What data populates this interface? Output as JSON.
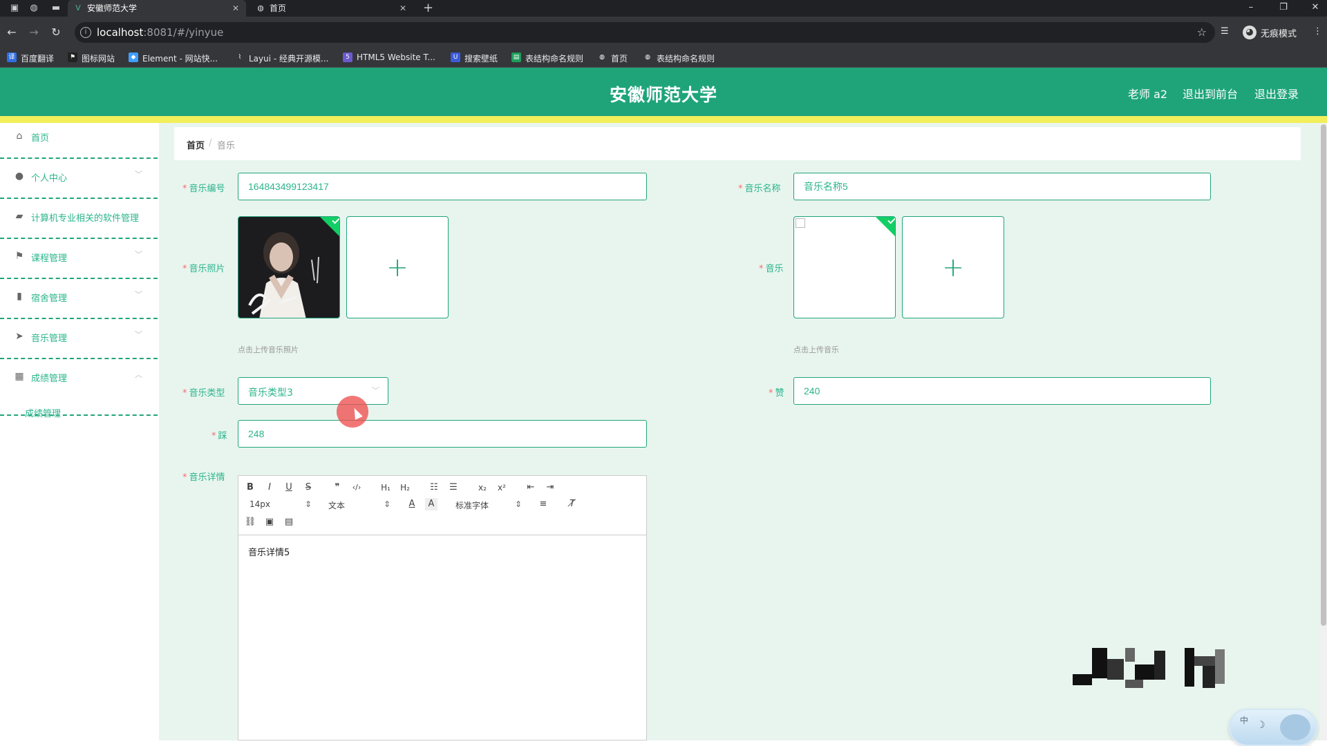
{
  "browser": {
    "tabs": [
      {
        "title": "安徽师范大学",
        "active": true
      },
      {
        "title": "首页",
        "active": false
      }
    ],
    "url_host": "localhost",
    "url_rest": ":8081/#/yinyue",
    "profile_label": "无痕模式",
    "bookmarks": [
      "百度翻译",
      "图标网站",
      "Element - 网站快...",
      "Layui - 经典开源模...",
      "HTML5 Website T...",
      "搜索壁纸",
      "表结构命名规则",
      "首页",
      "表结构命名规则"
    ]
  },
  "header": {
    "title": "安徽师范大学",
    "user": "老师 a2",
    "to_front": "退出到前台",
    "logout": "退出登录"
  },
  "sidebar": {
    "items": [
      {
        "label": "首页",
        "icon": "home-icon",
        "chevron": false
      },
      {
        "label": "个人中心",
        "icon": "user-icon",
        "chevron": true
      },
      {
        "label": "计算机专业相关的软件管理",
        "icon": "briefcase-icon",
        "chevron": false
      },
      {
        "label": "课程管理",
        "icon": "flag-icon",
        "chevron": true
      },
      {
        "label": "宿舍管理",
        "icon": "bar-chart-icon",
        "chevron": true
      },
      {
        "label": "音乐管理",
        "icon": "send-icon",
        "chevron": true
      },
      {
        "label": "成绩管理",
        "icon": "grid-icon",
        "chevron": true
      }
    ],
    "sub_item": "成绩管理"
  },
  "breadcrumb": {
    "home": "首页",
    "sep": "/",
    "current": "音乐"
  },
  "form": {
    "music_no_label": "音乐编号",
    "music_no_value": "164843499123417",
    "music_name_label": "音乐名称",
    "music_name_value": "音乐名称5",
    "photo_label": "音乐照片",
    "photo_hint": "点击上传音乐照片",
    "music_label": "音乐",
    "music_hint": "点击上传音乐",
    "type_label": "音乐类型",
    "type_value": "音乐类型3",
    "like_label": "赞",
    "like_value": "240",
    "dislike_label": "踩",
    "dislike_value": "248",
    "detail_label": "音乐详情",
    "detail_value": "音乐详情5",
    "plus": "+"
  },
  "editor": {
    "font_size": "14px",
    "block_type": "文本",
    "font_family": "标准字体"
  },
  "widget": {
    "label": "中"
  },
  "colors": {
    "brand": "#1fa47a",
    "accent_text": "#2bb58b",
    "highlight_bar": "#f3ef5a",
    "required": "#f56c6c"
  }
}
